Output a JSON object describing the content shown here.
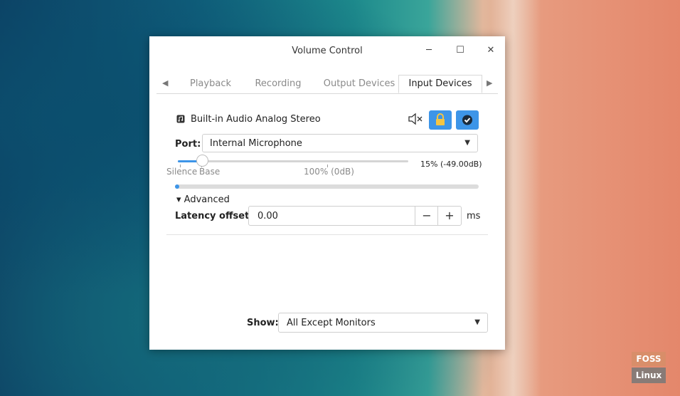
{
  "window": {
    "title": "Volume Control",
    "minimize_glyph": "─",
    "maximize_glyph": "☐",
    "close_glyph": "✕"
  },
  "tabs": [
    {
      "label": "Playback",
      "active": false
    },
    {
      "label": "Recording",
      "active": false
    },
    {
      "label": "Output Devices",
      "active": false
    },
    {
      "label": "Input Devices",
      "active": true
    }
  ],
  "device": {
    "name": "Built-in Audio Analog Stereo",
    "icon": "music-note-icon",
    "mute_icon": "speaker-muted-icon",
    "lock_icon": "lock-icon",
    "default_icon": "checkmark-icon",
    "port_label": "Port:",
    "port_value": "Internal Microphone",
    "volume_fraction": 0.15,
    "volume_readout": "15% (-49.00dB)",
    "tick_silence": "Silence",
    "tick_base": "Base",
    "tick_100": "100% (0dB)",
    "meter_level": 0.01,
    "advanced_label": "Advanced",
    "latency_label": "Latency offset:",
    "latency_value": "0.00",
    "latency_unit": "ms",
    "minus_glyph": "−",
    "plus_glyph": "+"
  },
  "footer": {
    "show_label": "Show:",
    "show_value": "All Except Monitors"
  },
  "watermark": {
    "line1": "FOSS",
    "line2": "Linux"
  },
  "colors": {
    "accent": "#3d95e8",
    "lock_yellow": "#f5c542"
  }
}
